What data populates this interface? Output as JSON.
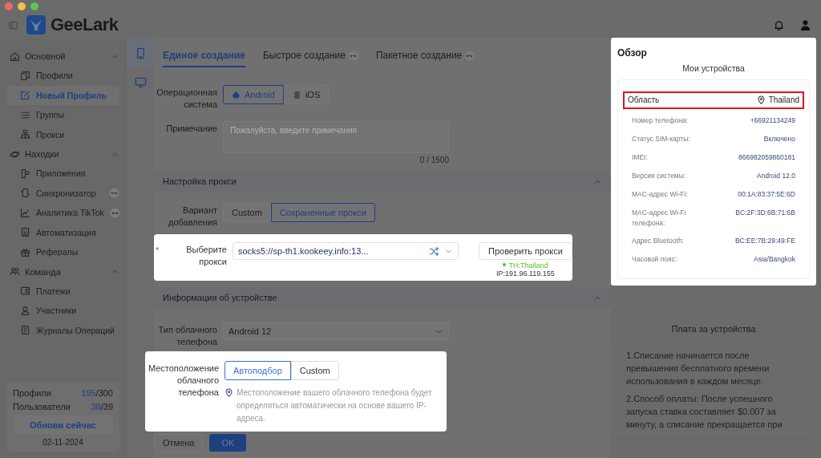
{
  "logo": {
    "text": "GeeLark"
  },
  "sidebar": {
    "groups": [
      {
        "label": "Основной",
        "expanded": true,
        "items": [
          {
            "label": "Профили",
            "selected": false
          },
          {
            "label": "Новый Профиль",
            "selected": true
          },
          {
            "label": "Группы",
            "selected": false
          },
          {
            "label": "Прокси",
            "selected": false
          }
        ]
      },
      {
        "label": "Находки",
        "expanded": true,
        "items": [
          {
            "label": "Приложения",
            "selected": false,
            "badge": false
          },
          {
            "label": "Синхронизатор",
            "selected": false,
            "badge": true
          },
          {
            "label": "Аналитика TikTok",
            "selected": false,
            "badge": true
          },
          {
            "label": "Автоматизация",
            "selected": false,
            "badge": false
          },
          {
            "label": "Рефералы",
            "selected": false,
            "badge": false
          }
        ]
      },
      {
        "label": "Команда",
        "expanded": true,
        "items": [
          {
            "label": "Платежи",
            "selected": false
          },
          {
            "label": "Участники",
            "selected": false
          },
          {
            "label": "Журналы Операций",
            "selected": false
          }
        ]
      }
    ],
    "stats": [
      {
        "label": "Профили",
        "used": "195",
        "total": "/300"
      },
      {
        "label": "Пользователи",
        "used": "38",
        "total": "/39"
      }
    ],
    "upgrade_button": "Обнови сейчас",
    "date": "02-11-2024"
  },
  "device_rail": [
    {
      "selected": true
    },
    {
      "selected": false
    }
  ],
  "tabs": [
    {
      "label": "Единое создание",
      "selected": true,
      "badge": false
    },
    {
      "label": "Быстрое создание",
      "selected": false,
      "badge": true
    },
    {
      "label": "Пакетное создание",
      "selected": false,
      "badge": true
    }
  ],
  "form": {
    "os": {
      "label": "Операционная система",
      "options": [
        {
          "label": "Android",
          "selected": true
        },
        {
          "label": "iOS",
          "selected": false
        }
      ]
    },
    "note": {
      "label": "Примечание",
      "placeholder": "Пожалуйста, введите примечания",
      "counter": "0 / 1500"
    },
    "proxy_section": {
      "title": "Настройка прокси",
      "expanded": true,
      "add_variant": {
        "label": "Вариант добавления",
        "options": [
          {
            "label": "Custom",
            "selected": false
          },
          {
            "label": "Сохраненные прокси",
            "selected": true
          }
        ]
      },
      "proxy": {
        "label": "Выберите прокси",
        "required_mark": "*",
        "highlighted": true,
        "value": "socks5://sp-th1.kookeey.info:13...",
        "check_button": "Проверить прокси",
        "location": "TH:Thailand",
        "ip": "IP:191.96.119.155"
      }
    },
    "device_section": {
      "title": "Информация об устройстве",
      "expanded": true,
      "phone_type": {
        "label": "Тип облачного телефона",
        "value": "Android 12"
      },
      "location": {
        "label": "Местоположение облачного телефона",
        "highlighted": true,
        "options": [
          {
            "label": "Автоподбор",
            "selected": true
          },
          {
            "label": "Custom",
            "selected": false
          }
        ],
        "hint": "Местоположение вашего облачного телефона будет определяться автоматически на основе вашего IP-адреса."
      }
    },
    "cancel_button": "Отмена",
    "ok_button": "OK"
  },
  "overview": {
    "title": "Обзор",
    "highlighted": true,
    "subtitle": "Мои устройства",
    "rows": [
      {
        "label": "Область",
        "value": "Thailand",
        "highlighted": true
      },
      {
        "label": "Номер телефона:",
        "value": "+66921134249",
        "highlighted": false
      },
      {
        "label": "Статус SIM-карты:",
        "value": "Включено",
        "highlighted": false
      },
      {
        "label": "IMEI:",
        "value": "866982059860181",
        "highlighted": false
      },
      {
        "label": "Версия системы:",
        "value": "Android 12.0",
        "highlighted": false
      },
      {
        "label": "MAC-адрес Wi-Fi:",
        "value": "00:1A:83:37:5E:6D",
        "highlighted": false
      },
      {
        "label": "MAC-адрес Wi-Fi телефона:",
        "value": "BC:2F:3D:6B:71:6B",
        "highlighted": false
      },
      {
        "label": "Адрес Bluetooth:",
        "value": "BC:EE:7B:29:49:FE",
        "highlighted": false
      },
      {
        "label": "Часовой пояс:",
        "value": "Asia/Bangkok",
        "highlighted": false
      }
    ]
  },
  "fees": {
    "title": "Плата за устройства",
    "paragraphs": [
      "1.Списание начинается после превышения бесплатного времени использования в каждом месяце.",
      "2.Способ оплаты: После успешного запуска ставка составляет $0.007 за минуту, а списание прекращается при"
    ]
  }
}
